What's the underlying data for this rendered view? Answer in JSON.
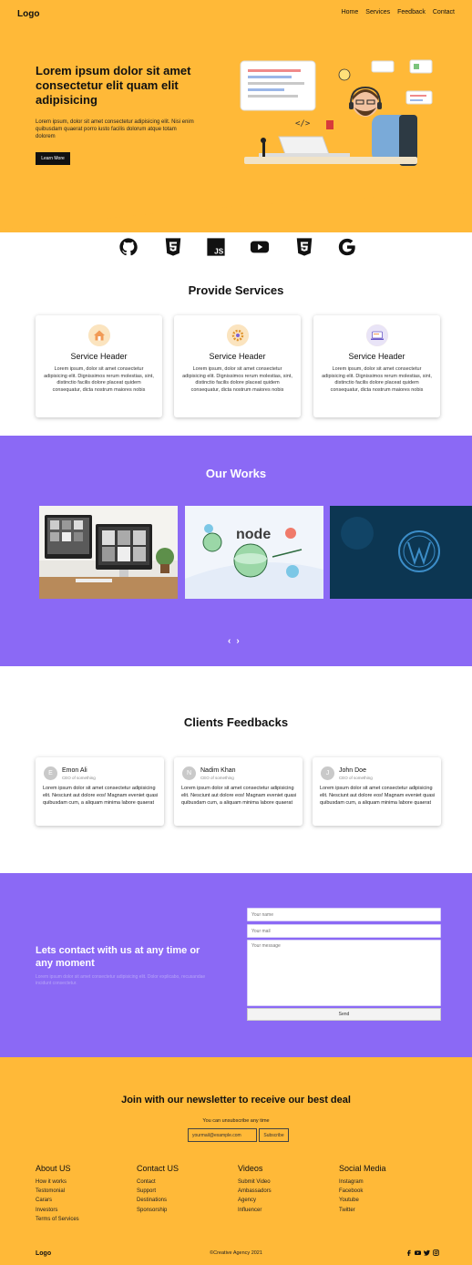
{
  "nav": {
    "logo": "Logo",
    "links": [
      "Home",
      "Services",
      "Feedback",
      "Contact"
    ]
  },
  "hero": {
    "title": "Lorem ipsum dolor sit amet consectetur elit quam elit adipisicing",
    "text": "Lorem ipsum, dolor sit amet consectetur adipisicing elit. Nisi enim quibusdam quaerat porro iusto facilis dolorum atque totam dolorem",
    "button": "Learn More",
    "illustration": "developer-at-desk-illustration"
  },
  "tech_icons": [
    "github-icon",
    "html5-icon",
    "javascript-icon",
    "youtube-icon",
    "css3-icon",
    "google-icon"
  ],
  "services": {
    "title": "Provide Services",
    "cards": [
      {
        "icon": "house-icon",
        "title": "Service Header",
        "text": "Lorem ipsum, dolor sit amet consectetur adipisicing elit. Dignissimos rerum molestias, sint, distinctio facilis dolore placeat quidem consequatur, dicta nostrum maiores nobis"
      },
      {
        "icon": "gear-icon",
        "title": "Service Header",
        "text": "Lorem ipsum, dolor sit amet consectetur adipisicing elit. Dignissimos rerum molestias, sint, distinctio facilis dolore placeat quidem consequatur, dicta nostrum maiores nobis"
      },
      {
        "icon": "laptop-icon",
        "title": "Service Header",
        "text": "Lorem ipsum, dolor sit amet consectetur adipisicing elit. Dignissimos rerum molestias, sint, distinctio facilis dolore placeat quidem consequatur, dicta nostrum maiores nobis"
      }
    ]
  },
  "works": {
    "title": "Our Works",
    "images": [
      "desk-computers-photo",
      "nodejs-illustration",
      "wordpress-logo-photo"
    ],
    "prev": "‹",
    "next": "›"
  },
  "feedback": {
    "title": "Clients Feedbacks",
    "cards": [
      {
        "initial": "E",
        "name": "Emon Ali",
        "role": "CEO of something",
        "text": "Lorem ipsum dolor sit amet consectetur adipisicing elit. Nesciunt aut dolore eos! Magnam eveniet quasi quibusdam cum, a aliquam minima labore quaerat"
      },
      {
        "initial": "N",
        "name": "Nadim Khan",
        "role": "CEO of something",
        "text": "Lorem ipsum dolor sit amet consectetur adipisicing elit. Nesciunt aut dolore eos! Magnam eveniet quasi quibusdam cum, a aliquam minima labore quaerat"
      },
      {
        "initial": "J",
        "name": "John Doe",
        "role": "CEO of something",
        "text": "Lorem ipsum dolor sit amet consectetur adipisicing elit. Nesciunt aut dolore eos! Magnam eveniet quasi quibusdam cum, a aliquam minima labore quaerat"
      }
    ]
  },
  "contact": {
    "title": "Lets contact with us at any time or any moment",
    "text": "Lorem ipsum dolor sit amet consectetur adipisicing elit. Dolor explicabo, recusandae incidunt consectetur.",
    "name_placeholder": "Your name",
    "email_placeholder": "Your mail",
    "message_placeholder": "Your message",
    "send": "Send"
  },
  "newsletter": {
    "title": "Join with our newsletter to receive our best deal",
    "sub": "You can unsubscribe any time",
    "placeholder": "yourmail@example.com",
    "button": "Subscribe"
  },
  "footer": {
    "columns": [
      {
        "title": "About US",
        "links": [
          "How it works",
          "Testomonial",
          "Carars",
          "Investors",
          "Terms of Services"
        ]
      },
      {
        "title": "Contact US",
        "links": [
          "Contact",
          "Support",
          "Destinations",
          "Sponsorship"
        ]
      },
      {
        "title": "Videos",
        "links": [
          "Submit Video",
          "Ambassadors",
          "Agency",
          "Influencer"
        ]
      },
      {
        "title": "Social Media",
        "links": [
          "Instagram",
          "Facebook",
          "Youtube",
          "Twitter"
        ]
      }
    ],
    "logo": "Logo",
    "copyright": "©Creative Agency 2021",
    "social": [
      "facebook-icon",
      "youtube-icon",
      "twitter-icon",
      "instagram-icon"
    ]
  },
  "colors": {
    "primary_yellow": "#ffb938",
    "primary_purple": "#8b69f5",
    "dark": "#111111"
  }
}
